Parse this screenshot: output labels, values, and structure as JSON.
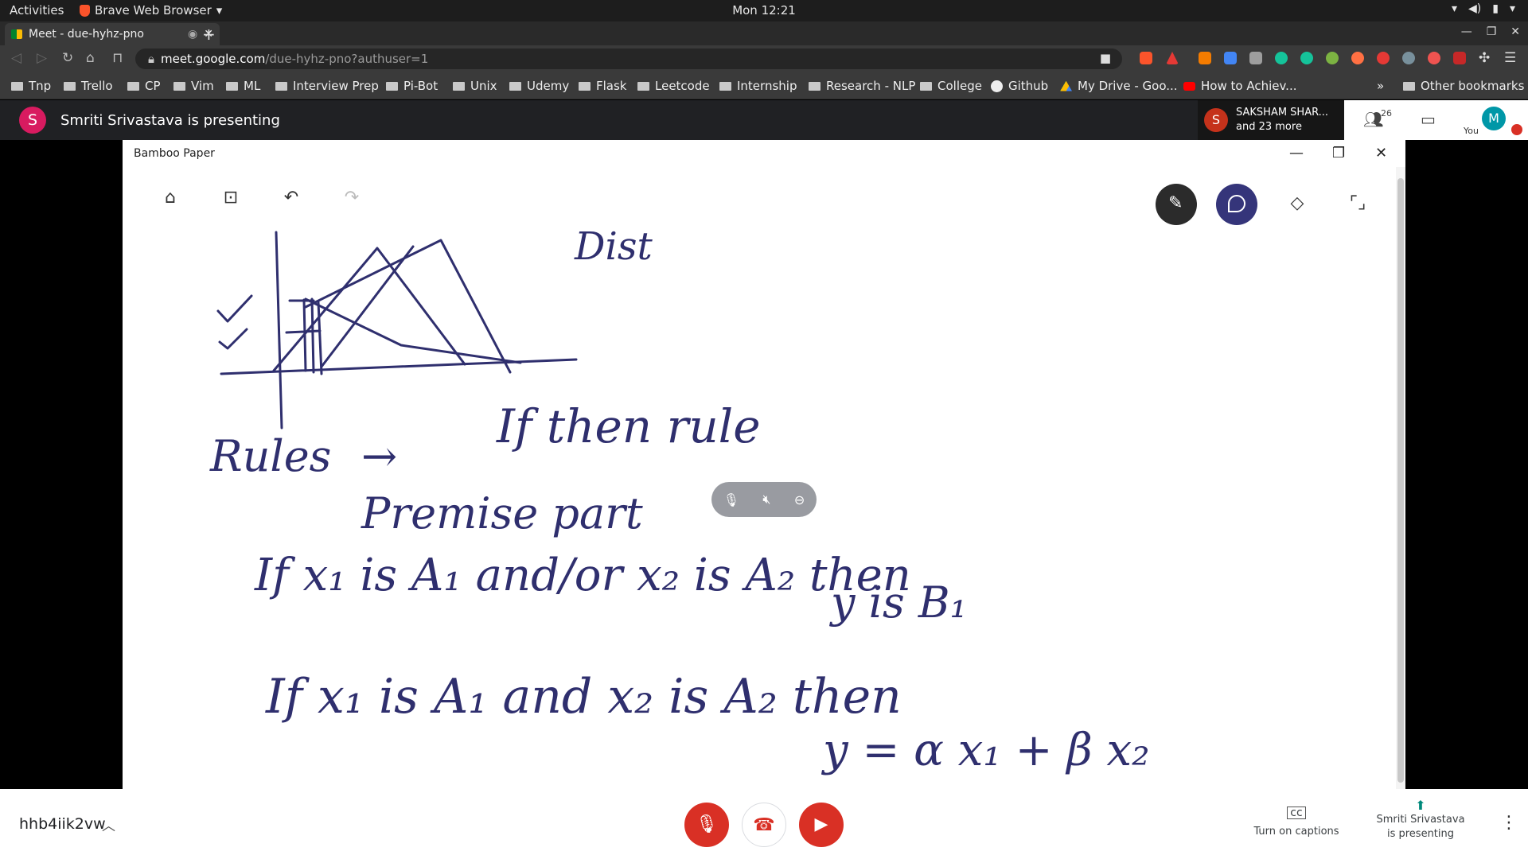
{
  "system": {
    "activities": "Activities",
    "app_name": "Brave Web Browser",
    "clock": "Mon 12:21"
  },
  "browser": {
    "tab_title": "Meet - due-hyhz-pno",
    "url_host": "meet.google.com",
    "url_path": "/due-hyhz-pno?authuser=1",
    "bookmarks": [
      "Tnp",
      "Trello",
      "CP",
      "Vim",
      "ML",
      "Interview Prep",
      "Pi-Bot",
      "Unix",
      "Udemy",
      "Flask",
      "Leetcode",
      "Internship",
      "Research - NLP",
      "College",
      "Github",
      "My Drive - Goo...",
      "How to Achiev..."
    ],
    "more_bookmarks": "»",
    "other_bookmarks": "Other bookmarks"
  },
  "meet": {
    "presenter_initial": "S",
    "presenting_banner": "Smriti Srivastava is presenting",
    "participant_initial": "S",
    "participant_name": "SAKSHAM SHAR...",
    "participant_more": "and 23 more",
    "participant_count": "26",
    "self_initial": "M",
    "self_label": "You",
    "meeting_code": "hhb4iik2vw",
    "captions_label": "Turn on captions",
    "presenting_line1": "Smriti Srivastava",
    "presenting_line2": "is presenting",
    "colors": {
      "danger": "#d93025",
      "teal": "#00897b",
      "ink": "#2f2f6e"
    }
  },
  "bamboo": {
    "window_title": "Bamboo Paper",
    "notes": {
      "dist": "Dist",
      "rules": "Rules",
      "arrow": "→",
      "if_then": "If  then  rule",
      "premise": "Premise part",
      "line1": "If  x₁  is  A₁  and/or   x₂ is  A₂   then",
      "line2": "y  is  B₁",
      "line3": "If  x₁  is  A₁  and  x₂ is  A₂  then",
      "line4": "y = α x₁ + β x₂"
    }
  }
}
